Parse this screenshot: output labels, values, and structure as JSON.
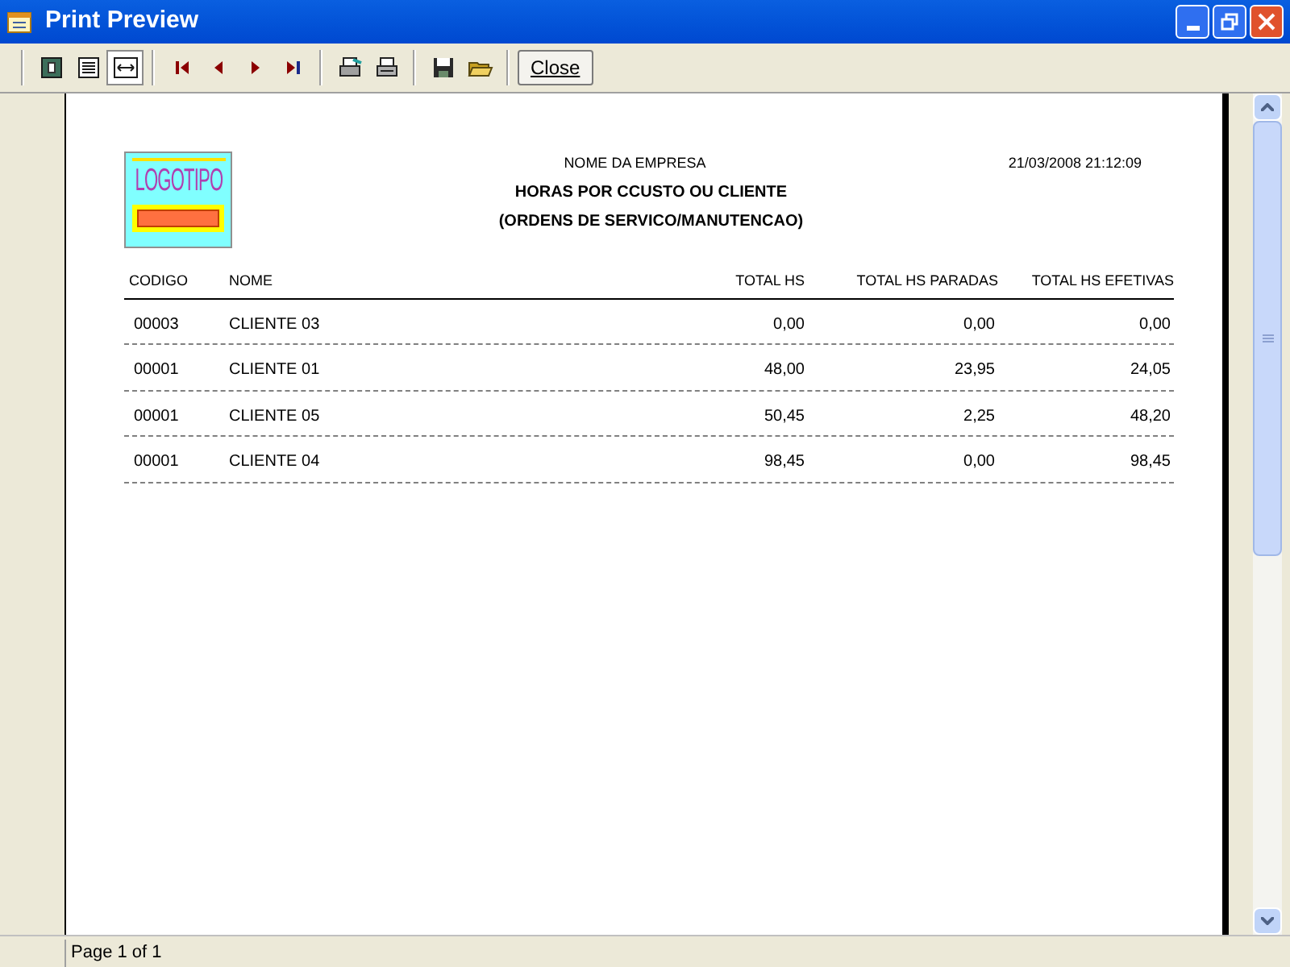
{
  "window": {
    "title": "Print Preview"
  },
  "toolbar": {
    "groups": [
      [
        {
          "kind": "single-page",
          "selected": false
        },
        {
          "kind": "multi-page",
          "selected": false
        },
        {
          "kind": "page-width",
          "selected": true
        }
      ],
      [
        {
          "kind": "first"
        },
        {
          "kind": "prev"
        },
        {
          "kind": "next"
        },
        {
          "kind": "last"
        }
      ],
      [
        {
          "kind": "print-setup"
        },
        {
          "kind": "print"
        }
      ],
      [
        {
          "kind": "save"
        },
        {
          "kind": "open"
        }
      ]
    ],
    "close_button": "Close"
  },
  "report": {
    "logo_text": "LOGOTIPO",
    "company": "NOME DA EMPRESA",
    "title": "HORAS POR CCUSTO OU CLIENTE",
    "subtitle": "(ORDENS DE SERVICO/MANUTENCAO)",
    "timestamp": "21/03/2008 21:12:09",
    "columns": [
      "CODIGO",
      "NOME",
      "TOTAL HS",
      "TOTAL HS PARADAS",
      "TOTAL HS EFETIVAS"
    ],
    "rows": [
      [
        "00003",
        "CLIENTE 03",
        "0,00",
        "0,00",
        "0,00"
      ],
      [
        "00001",
        "CLIENTE 01",
        "48,00",
        "23,95",
        "24,05"
      ],
      [
        "00001",
        "CLIENTE 05",
        "50,45",
        "2,25",
        "48,20"
      ],
      [
        "00001",
        "CLIENTE 04",
        "98,45",
        "0,00",
        "98,45"
      ]
    ]
  },
  "status_bar": {
    "page": "Page 1 of 1"
  }
}
